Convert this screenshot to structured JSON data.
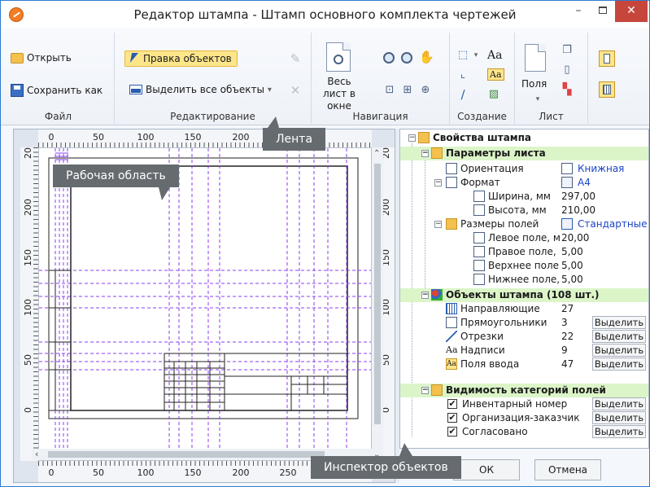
{
  "window": {
    "title": "Редактор штампа - Штамп основного комплекта чертежей",
    "minimize": "–",
    "close": "✕"
  },
  "ribbon": {
    "file": {
      "label": "Файл",
      "open": "Открыть",
      "save_as": "Сохранить как"
    },
    "editing": {
      "label": "Редактирование",
      "edit_objects": "Правка объектов",
      "select_all": "Выделить все объекты",
      "select_all_arrow": "▾"
    },
    "navigation": {
      "label": "Навигация",
      "whole_sheet": "Весь лист в окне"
    },
    "creation": {
      "label": "Создание",
      "text_icon": "Aa",
      "field_icon": "Aa"
    },
    "sheet": {
      "label": "Лист",
      "margins": "Поля"
    }
  },
  "rulers": {
    "top": [
      "0",
      "50",
      "100",
      "150",
      "200"
    ],
    "bottom": [
      "0",
      "50",
      "100",
      "150",
      "200",
      "250"
    ],
    "left": [
      "200",
      "150",
      "100",
      "50",
      "0"
    ],
    "left_top_cut": "20",
    "right": [
      "200",
      "150",
      "100",
      "50",
      "0"
    ]
  },
  "inspector": {
    "root": "Свойства штампа",
    "sheet_params": {
      "label": "Параметры листа",
      "orientation_label": "Ориентация",
      "orientation_value": "Книжная",
      "format_label": "Формат",
      "format_value": "А4",
      "width_label": "Ширина, мм",
      "width_value": "297,00",
      "height_label": "Высота, мм",
      "height_value": "210,00",
      "margins_label": "Размеры полей",
      "margins_value": "Стандартные",
      "left_label": "Левое поле, м",
      "left_value": "20,00",
      "right_label": "Правое поле,",
      "right_value": "5,00",
      "top_label": "Верхнее поле",
      "top_value": "5,00",
      "bottom_label": "Нижнее поле,",
      "bottom_value": "5,00"
    },
    "objects": {
      "label": "Объекты штампа (108 шт.)",
      "select_button": "Выделить",
      "items": [
        {
          "label": "Направляющие",
          "count": "27",
          "icon": "guides-icon",
          "has_button": false
        },
        {
          "label": "Прямоугольники",
          "count": "3",
          "icon": "rectangle-icon",
          "has_button": true
        },
        {
          "label": "Отрезки",
          "count": "22",
          "icon": "line-icon",
          "has_button": true
        },
        {
          "label": "Надписи",
          "count": "9",
          "icon": "text-icon",
          "has_button": true
        },
        {
          "label": "Поля ввода",
          "count": "47",
          "icon": "input-field-icon",
          "has_button": true
        }
      ]
    },
    "visibility": {
      "label": "Видимость категорий полей",
      "items": [
        {
          "label": "Инвентарный номер",
          "checked": true
        },
        {
          "label": "Организация-заказчик",
          "checked": true
        },
        {
          "label": "Согласовано",
          "checked": true
        }
      ]
    }
  },
  "dialog": {
    "ok": "ОК",
    "cancel": "Отмена"
  },
  "callouts": {
    "ribbon": "Лента",
    "workspace": "Рабочая область",
    "inspector": "Инспектор объектов"
  },
  "colors": {
    "accent": "#2b7bd3",
    "close_button": "#c7463c",
    "category_row": "#dcf5c8",
    "guide_line": "#8a3ff0",
    "callout": "#666b70",
    "highlight": "#fde58b"
  }
}
